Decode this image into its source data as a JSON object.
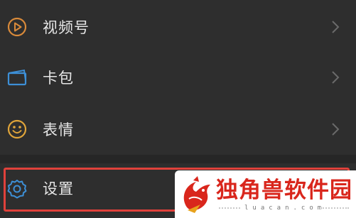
{
  "menu": {
    "items": [
      {
        "label": "视频号",
        "icon": "channels-play-icon",
        "icon_color": "#d98a3a"
      },
      {
        "label": "卡包",
        "icon": "card-wallet-icon",
        "icon_color": "#3d8fd6"
      },
      {
        "label": "表情",
        "icon": "smiley-icon",
        "icon_color": "#e0a53a"
      },
      {
        "label": "设置",
        "icon": "gear-icon",
        "icon_color": "#3d8fd6"
      }
    ]
  },
  "highlight": {
    "color": "#e0413b"
  },
  "watermark": {
    "title": "独角兽软件园",
    "subtitle": "luacan.com",
    "title_color": "#d9261c"
  },
  "colors": {
    "background": "#2e2e2e",
    "text": "#e6e6e6",
    "chevron": "#6a6a6a"
  }
}
